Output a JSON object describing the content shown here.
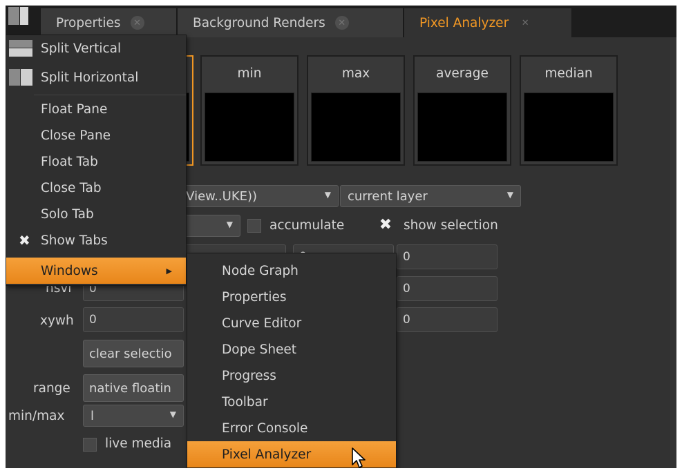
{
  "tabs": [
    {
      "label": "Properties",
      "active": false
    },
    {
      "label": "Background Renders",
      "active": false
    },
    {
      "label": "Pixel Analyzer",
      "active": true
    }
  ],
  "swatches": [
    {
      "label": "min"
    },
    {
      "label": "max"
    },
    {
      "label": "average"
    },
    {
      "label": "median"
    }
  ],
  "analyzer": {
    "source_dropdown": "r (View..UKE))",
    "layer_dropdown": "current layer",
    "mode_dropdown": "n",
    "accumulate_label": "accumulate",
    "show_selection_label": "show selection",
    "rgba_values": [
      "0",
      "0",
      "0"
    ],
    "hsvl_label": "hsvl",
    "hsvl_values": [
      "0",
      "0"
    ],
    "xywh_label": "xywh",
    "xywh_values": [
      "0",
      "0"
    ],
    "clear_selection": "clear selectio",
    "range_label": "range",
    "range_value": "native floatin",
    "minmax_label": "min/max",
    "minmax_value": "l",
    "live_median": "live media"
  },
  "pane_menu": {
    "items": [
      {
        "label": "Split Vertical",
        "icon": "split-vertical-icon"
      },
      {
        "label": "Split Horizontal",
        "icon": "split-horizontal-icon"
      },
      {
        "label": "Float Pane"
      },
      {
        "label": "Close Pane"
      },
      {
        "label": "Float Tab"
      },
      {
        "label": "Close Tab"
      },
      {
        "label": "Solo Tab"
      },
      {
        "label": "Show Tabs",
        "checked": true
      },
      {
        "label": "Windows",
        "highlighted": true,
        "submenu": true
      }
    ]
  },
  "windows_submenu": {
    "items": [
      {
        "label": "Node Graph"
      },
      {
        "label": "Properties"
      },
      {
        "label": "Curve Editor"
      },
      {
        "label": "Dope Sheet"
      },
      {
        "label": "Progress"
      },
      {
        "label": "Toolbar"
      },
      {
        "label": "Error Console"
      },
      {
        "label": "Pixel Analyzer",
        "highlighted": true
      }
    ]
  },
  "colors": {
    "accent": "#f29824",
    "background": "#323232",
    "tabbar": "#1d1d1d"
  }
}
